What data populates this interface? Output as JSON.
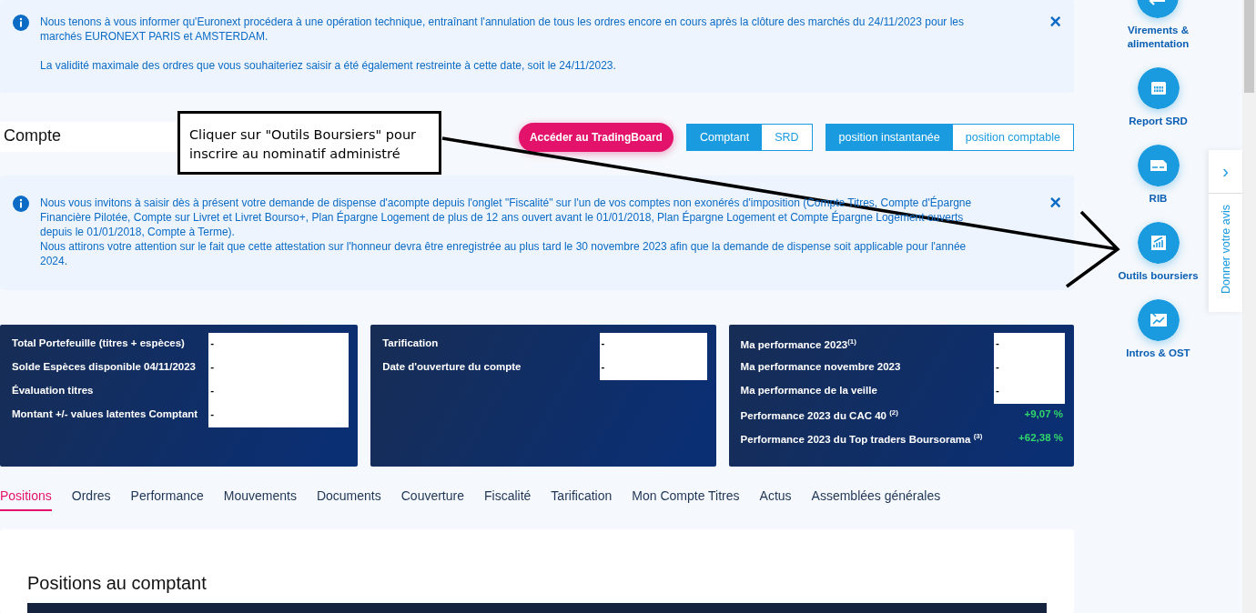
{
  "banners": [
    {
      "paragraphs": [
        "Nous tenons à vous informer qu'Euronext procédera à une opération technique, entraînant l'annulation de tous les ordres encore en cours après la clôture des marchés du 24/11/2023 pour les marchés EURONEXT PARIS et AMSTERDAM.",
        "La validité maximale des ordres que vous souhaiteriez saisir a été également restreinte à cette date, soit le 24/11/2023."
      ],
      "close": "×"
    },
    {
      "paragraphs": [
        "Nous vous invitons à saisir dès à présent votre demande de dispense d'acompte depuis l'onglet \"Fiscalité\" sur l'un de vos comptes non exonérés d'imposition (Compte Titres, Compte d'Épargne Financière Pilotée, Compte sur Livret et Livret Bourso+, Plan Épargne Logement de plus de 12 ans ouvert avant le 01/01/2018, Plan Épargne Logement et Compte Épargne Logement ouverts depuis le 01/01/2018, Compte à Terme).\nNous attirons votre attention sur le fait que cette attestation sur l'honneur devra être enregistrée au plus tard le 30 novembre 2023 afin que la demande de dispense soit applicable pour l'année 2024."
      ],
      "close": "×"
    }
  ],
  "header": {
    "title": "Compte",
    "trading_button": "Accéder au TradingBoard",
    "market_toggle": [
      {
        "label": "Comptant",
        "selected": true
      },
      {
        "label": "SRD",
        "selected": false
      }
    ],
    "position_toggle": [
      {
        "label": "position instantanée",
        "selected": true
      },
      {
        "label": "position comptable",
        "selected": false
      }
    ]
  },
  "annotation": {
    "text": "Cliquer sur \"Outils Boursiers\" pour inscrire au nominatif administré"
  },
  "cards": [
    {
      "rows": [
        {
          "label": "Total Portefeuille (titres + espèces)",
          "value": "-",
          "redacted": true
        },
        {
          "label": "Solde Espèces disponible 04/11/2023",
          "value": "-",
          "redacted": true
        },
        {
          "label": "Évaluation titres",
          "value": "-",
          "redacted": true
        },
        {
          "label": "Montant +/- values latentes Comptant",
          "value": "-",
          "redacted": true
        }
      ]
    },
    {
      "rows": [
        {
          "label": "Tarification",
          "value": "-",
          "redacted": true
        },
        {
          "label": "Date d'ouverture du compte",
          "value": "-",
          "redacted": true
        }
      ]
    },
    {
      "rows": [
        {
          "label": "Ma performance 2023$^{(1)}$",
          "value": "-",
          "redacted": true
        },
        {
          "label": "Ma performance novembre 2023",
          "value": "-",
          "redacted": true
        },
        {
          "label": "Ma performance de la veille",
          "value": "-",
          "redacted": true
        },
        {
          "label": "Performance 2023 du CAC 40 $^{(2)}$",
          "value": "+9,07 %",
          "redacted": false
        },
        {
          "label": "Performance 2023 du Top traders Boursorama $^{(3)}$",
          "value": "+62,38 %",
          "redacted": false
        }
      ]
    }
  ],
  "tabs": [
    {
      "label": "Positions",
      "selected": true
    },
    {
      "label": "Ordres",
      "selected": false
    },
    {
      "label": "Performance",
      "selected": false
    },
    {
      "label": "Mouvements",
      "selected": false
    },
    {
      "label": "Documents",
      "selected": false
    },
    {
      "label": "Couverture",
      "selected": false
    },
    {
      "label": "Fiscalité",
      "selected": false
    },
    {
      "label": "Tarification",
      "selected": false
    },
    {
      "label": "Mon Compte Titres",
      "selected": false
    },
    {
      "label": "Actus",
      "selected": false
    },
    {
      "label": "Assemblées générales",
      "selected": false
    }
  ],
  "section_title": "Positions au comptant",
  "sidebar": {
    "items": [
      {
        "label": "Virements &\nalimentation",
        "kind": "transfer"
      },
      {
        "label": "Report SRD",
        "kind": "calendar"
      },
      {
        "label": "RIB",
        "kind": "card"
      },
      {
        "label": "Outils boursiers",
        "kind": "chart"
      },
      {
        "label": "Intros & OST",
        "kind": "intro"
      }
    ]
  },
  "feedback": {
    "arrow": "›",
    "label": "Donner votre avis"
  }
}
